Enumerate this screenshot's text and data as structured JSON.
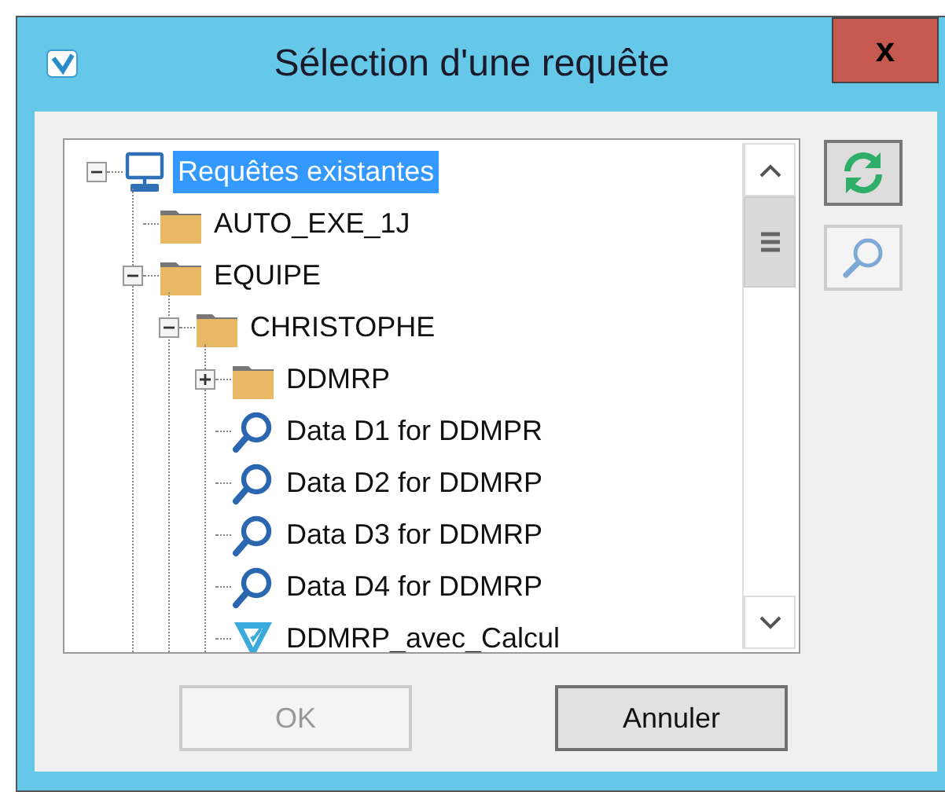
{
  "window": {
    "title": "Sélection d'une requête",
    "close": "x"
  },
  "tree": [
    {
      "label": "Requêtes existantes",
      "kind": "computer",
      "selected": true,
      "expanded": true,
      "children": [
        {
          "label": "AUTO_EXE_1J",
          "kind": "folder",
          "selected": false
        },
        {
          "label": "EQUIPE",
          "kind": "folder",
          "selected": false,
          "expanded": true,
          "children": [
            {
              "label": "CHRISTOPHE",
              "kind": "folder",
              "selected": false,
              "expanded": true,
              "children": [
                {
                  "label": "DDMRP",
                  "kind": "folder",
                  "selected": false,
                  "expanded": false
                },
                {
                  "label": "Data D1 for DDMPR",
                  "kind": "query",
                  "selected": false
                },
                {
                  "label": "Data D2 for DDMRP",
                  "kind": "query",
                  "selected": false
                },
                {
                  "label": "Data D3 for DDMRP",
                  "kind": "query",
                  "selected": false
                },
                {
                  "label": "Data D4 for DDMRP",
                  "kind": "query",
                  "selected": false
                },
                {
                  "label": "DDMRP_avec_Calcul",
                  "kind": "view",
                  "selected": false
                }
              ]
            }
          ]
        }
      ]
    }
  ],
  "side_buttons": [
    {
      "kind": "refresh",
      "disabled": false
    },
    {
      "kind": "search",
      "disabled": true
    }
  ],
  "buttons": [
    {
      "label": "OK",
      "disabled": true
    },
    {
      "label": "Annuler",
      "disabled": false
    }
  ]
}
